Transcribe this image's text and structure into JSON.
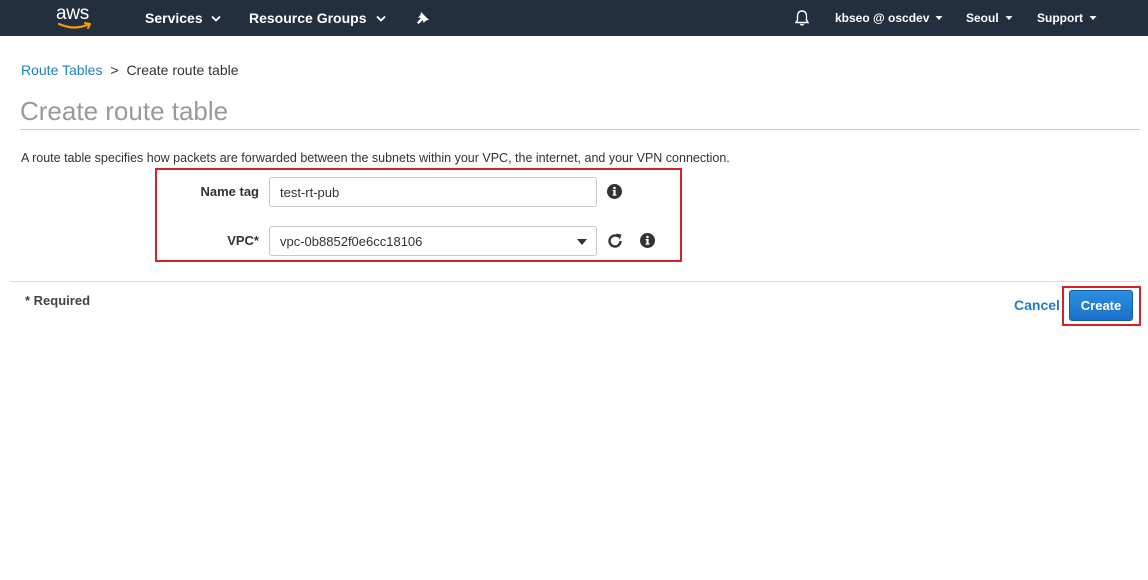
{
  "nav": {
    "logo": "aws",
    "services_label": "Services",
    "resource_groups_label": "Resource Groups",
    "account_label": "kbseo @ oscdev",
    "region_label": "Seoul",
    "support_label": "Support"
  },
  "breadcrumb": {
    "parent": "Route Tables",
    "separator": ">",
    "current": "Create route table"
  },
  "page": {
    "title": "Create route table",
    "description": "A route table specifies how packets are forwarded between the subnets within your VPC, the internet, and your VPN connection."
  },
  "form": {
    "name_tag_label": "Name tag",
    "name_tag_value": "test-rt-pub",
    "vpc_label": "VPC*",
    "vpc_value": "vpc-0b8852f0e6cc18106"
  },
  "footer": {
    "required_note": "* Required",
    "cancel_label": "Cancel",
    "create_label": "Create"
  },
  "colors": {
    "nav_bg": "#232f3e",
    "link": "#1d7fc1",
    "primary_button": "#1a6fc9",
    "highlight": "#d9202a",
    "logo_smile": "#ff9900"
  }
}
